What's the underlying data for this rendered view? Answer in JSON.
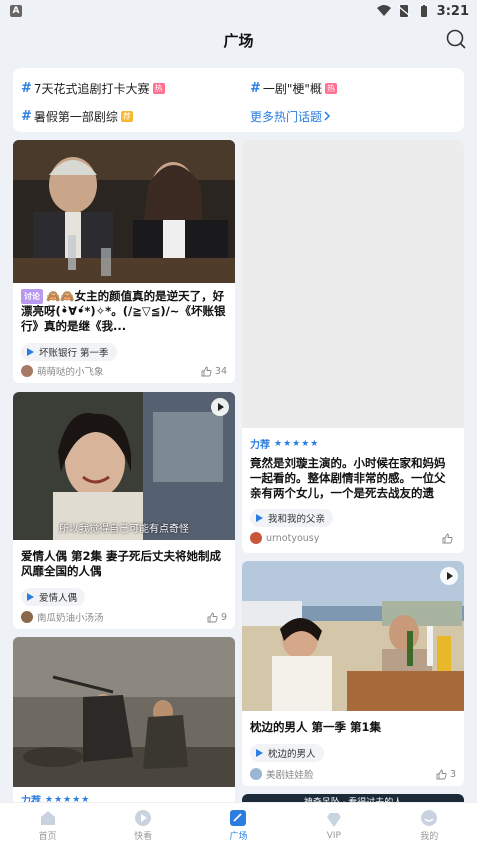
{
  "status": {
    "time": "3:21",
    "left_icon": "A"
  },
  "header": {
    "title": "广场"
  },
  "topics": {
    "items": [
      {
        "label": "7天花式追剧打卡大赛",
        "badge": "热"
      },
      {
        "label": "一剧\"梗\"概",
        "badge": "热"
      },
      {
        "label": "暑假第一部剧综",
        "badge": "荐"
      }
    ],
    "more_label": "更多热门话题"
  },
  "cards": {
    "c1": {
      "tag": "讨论",
      "title": "女主的颜值真的是逆天了，好漂亮呀(•̀∀•́*)✧*。(/≧▽≦)/~《坏账银行》真的是继《我...",
      "emoji": "🙈🙈",
      "show": "坏账银行 第一季",
      "author": "萌萌哒的小飞象",
      "likes": "34"
    },
    "c2": {
      "recommend": "力荐",
      "stars": "★★★★★",
      "title": "竟然是刘璇主演的。小时候在家和妈妈一起看的。整体剧情非常的感。一位父亲有两个女儿，一个是死去战友的遗孤，一...",
      "show": "我和我的父亲",
      "author": "urnotyousy",
      "likes": ""
    },
    "c3": {
      "subtitle": "所以我觉得自己可能有点奇怪",
      "title": "爱情人偶 第2集 妻子死后丈夫将她制成风靡全国的人偶",
      "show": "爱情人偶",
      "author": "南瓜奶油小汤汤",
      "likes": "9"
    },
    "c4": {
      "title": "枕边的男人 第一季 第1集",
      "show": "枕边的男人",
      "author": "美剧娃娃脸",
      "likes": "3"
    },
    "c5": {
      "recommend": "力荐",
      "stars": "★★★★★"
    },
    "c6": {
      "subtitle": "神奇吊坠 · 看得过去的人"
    }
  },
  "nav": {
    "items": [
      {
        "label": "首页"
      },
      {
        "label": "快看"
      },
      {
        "label": "广场"
      },
      {
        "label": "VIP"
      },
      {
        "label": "我的"
      }
    ]
  },
  "colors": {
    "accent": "#2a7de1",
    "hot_badge": "#ff6f8e",
    "recommend_badge": "#f7b733"
  }
}
